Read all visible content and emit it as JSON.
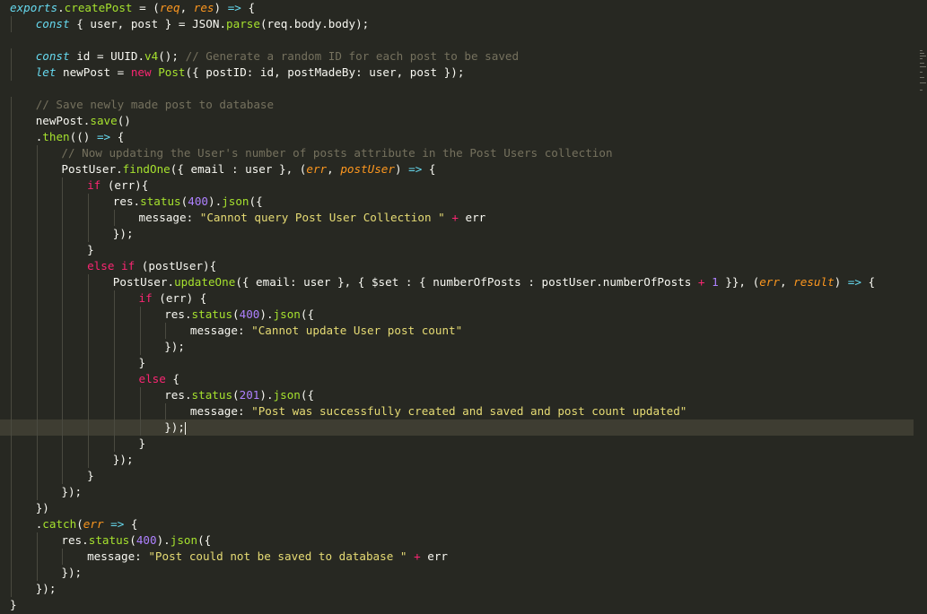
{
  "colors": {
    "background": "#272822",
    "active_line": "#3e3d32",
    "indent_guide": "#4a4a40",
    "plain": "#f8f8f2",
    "keyword": "#f92672",
    "storage": "#66d9ef",
    "function": "#a6e22e",
    "string": "#e6db74",
    "number": "#ae81ff",
    "parameter": "#fd971f",
    "comment": "#75715e"
  },
  "active_line_index": 26,
  "lines": [
    {
      "indent": 0,
      "tokens": [
        [
          "exports",
          "storage",
          true
        ],
        [
          ".",
          "plain"
        ],
        [
          "createPost",
          "function"
        ],
        [
          " = (",
          "plain"
        ],
        [
          "req",
          "parameter",
          true
        ],
        [
          ", ",
          "plain"
        ],
        [
          "res",
          "parameter",
          true
        ],
        [
          ") ",
          "plain"
        ],
        [
          "=>",
          "storage"
        ],
        [
          " {",
          "plain"
        ]
      ]
    },
    {
      "indent": 1,
      "tokens": [
        [
          "const",
          "storage",
          true
        ],
        [
          " { user, post } = ",
          "plain"
        ],
        [
          "JSON",
          "plain"
        ],
        [
          ".",
          "plain"
        ],
        [
          "parse",
          "function"
        ],
        [
          "(req.body.body);",
          "plain"
        ]
      ]
    },
    {
      "indent": 0,
      "tokens": []
    },
    {
      "indent": 1,
      "tokens": [
        [
          "const",
          "storage",
          true
        ],
        [
          " id = ",
          "plain"
        ],
        [
          "UUID",
          "plain"
        ],
        [
          ".",
          "plain"
        ],
        [
          "v4",
          "function"
        ],
        [
          "(); ",
          "plain"
        ],
        [
          "// Generate a random ID for each post to be saved",
          "comment"
        ]
      ]
    },
    {
      "indent": 1,
      "tokens": [
        [
          "let",
          "storage",
          true
        ],
        [
          " newPost = ",
          "plain"
        ],
        [
          "new",
          "keyword"
        ],
        [
          " ",
          "plain"
        ],
        [
          "Post",
          "function"
        ],
        [
          "({ postID: id, postMadeBy: user, post });",
          "plain"
        ]
      ]
    },
    {
      "indent": 0,
      "tokens": []
    },
    {
      "indent": 1,
      "tokens": [
        [
          "// Save newly made post to database",
          "comment"
        ]
      ]
    },
    {
      "indent": 1,
      "tokens": [
        [
          "newPost",
          "plain"
        ],
        [
          ".",
          "plain"
        ],
        [
          "save",
          "function"
        ],
        [
          "()",
          "plain"
        ]
      ]
    },
    {
      "indent": 1,
      "tokens": [
        [
          ".",
          "plain"
        ],
        [
          "then",
          "function"
        ],
        [
          "(() ",
          "plain"
        ],
        [
          "=>",
          "storage"
        ],
        [
          " {",
          "plain"
        ]
      ]
    },
    {
      "indent": 2,
      "tokens": [
        [
          "// Now updating the User's number of posts attribute in the Post Users collection",
          "comment"
        ]
      ]
    },
    {
      "indent": 2,
      "tokens": [
        [
          "PostUser",
          "plain"
        ],
        [
          ".",
          "plain"
        ],
        [
          "findOne",
          "function"
        ],
        [
          "({ email : user }, (",
          "plain"
        ],
        [
          "err",
          "parameter",
          true
        ],
        [
          ", ",
          "plain"
        ],
        [
          "postUser",
          "parameter",
          true
        ],
        [
          ") ",
          "plain"
        ],
        [
          "=>",
          "storage"
        ],
        [
          " {",
          "plain"
        ]
      ]
    },
    {
      "indent": 3,
      "tokens": [
        [
          "if",
          "keyword"
        ],
        [
          " (err){",
          "plain"
        ]
      ]
    },
    {
      "indent": 4,
      "tokens": [
        [
          "res",
          "plain"
        ],
        [
          ".",
          "plain"
        ],
        [
          "status",
          "function"
        ],
        [
          "(",
          "plain"
        ],
        [
          "400",
          "number"
        ],
        [
          ").",
          "plain"
        ],
        [
          "json",
          "function"
        ],
        [
          "({",
          "plain"
        ]
      ]
    },
    {
      "indent": 5,
      "tokens": [
        [
          "message: ",
          "plain"
        ],
        [
          "\"Cannot query Post User Collection \"",
          "string"
        ],
        [
          " ",
          "plain"
        ],
        [
          "+",
          "keyword"
        ],
        [
          " err",
          "plain"
        ]
      ]
    },
    {
      "indent": 4,
      "tokens": [
        [
          "});",
          "plain"
        ]
      ]
    },
    {
      "indent": 3,
      "tokens": [
        [
          "}",
          "plain"
        ]
      ]
    },
    {
      "indent": 3,
      "tokens": [
        [
          "else",
          "keyword"
        ],
        [
          " ",
          "plain"
        ],
        [
          "if",
          "keyword"
        ],
        [
          " (postUser){",
          "plain"
        ]
      ]
    },
    {
      "indent": 4,
      "tokens": [
        [
          "PostUser",
          "plain"
        ],
        [
          ".",
          "plain"
        ],
        [
          "updateOne",
          "function"
        ],
        [
          "({ email: user }, { $set : { numberOfPosts : postUser.numberOfPosts ",
          "plain"
        ],
        [
          "+",
          "keyword"
        ],
        [
          " ",
          "plain"
        ],
        [
          "1",
          "number"
        ],
        [
          " }}, (",
          "plain"
        ],
        [
          "err",
          "parameter",
          true
        ],
        [
          ", ",
          "plain"
        ],
        [
          "result",
          "parameter",
          true
        ],
        [
          ") ",
          "plain"
        ],
        [
          "=>",
          "storage"
        ],
        [
          " {",
          "plain"
        ]
      ]
    },
    {
      "indent": 5,
      "tokens": [
        [
          "if",
          "keyword"
        ],
        [
          " (err) {",
          "plain"
        ]
      ]
    },
    {
      "indent": 6,
      "tokens": [
        [
          "res",
          "plain"
        ],
        [
          ".",
          "plain"
        ],
        [
          "status",
          "function"
        ],
        [
          "(",
          "plain"
        ],
        [
          "400",
          "number"
        ],
        [
          ").",
          "plain"
        ],
        [
          "json",
          "function"
        ],
        [
          "({",
          "plain"
        ]
      ]
    },
    {
      "indent": 7,
      "tokens": [
        [
          "message: ",
          "plain"
        ],
        [
          "\"Cannot update User post count\"",
          "string"
        ]
      ]
    },
    {
      "indent": 6,
      "tokens": [
        [
          "});",
          "plain"
        ]
      ]
    },
    {
      "indent": 5,
      "tokens": [
        [
          "}",
          "plain"
        ]
      ]
    },
    {
      "indent": 5,
      "tokens": [
        [
          "else",
          "keyword"
        ],
        [
          " {",
          "plain"
        ]
      ]
    },
    {
      "indent": 6,
      "tokens": [
        [
          "res",
          "plain"
        ],
        [
          ".",
          "plain"
        ],
        [
          "status",
          "function"
        ],
        [
          "(",
          "plain"
        ],
        [
          "201",
          "number"
        ],
        [
          ").",
          "plain"
        ],
        [
          "json",
          "function"
        ],
        [
          "({",
          "plain"
        ]
      ]
    },
    {
      "indent": 7,
      "tokens": [
        [
          "message: ",
          "plain"
        ],
        [
          "\"Post was successfully created and saved and post count updated\"",
          "string"
        ]
      ]
    },
    {
      "indent": 6,
      "tokens": [
        [
          "});",
          "plain"
        ]
      ]
    },
    {
      "indent": 5,
      "tokens": [
        [
          "}",
          "plain"
        ]
      ]
    },
    {
      "indent": 4,
      "tokens": [
        [
          "});",
          "plain"
        ]
      ]
    },
    {
      "indent": 3,
      "tokens": [
        [
          "}",
          "plain"
        ]
      ]
    },
    {
      "indent": 2,
      "tokens": [
        [
          "});",
          "plain"
        ]
      ]
    },
    {
      "indent": 1,
      "tokens": [
        [
          "})",
          "plain"
        ]
      ]
    },
    {
      "indent": 1,
      "tokens": [
        [
          ".",
          "plain"
        ],
        [
          "catch",
          "function"
        ],
        [
          "(",
          "plain"
        ],
        [
          "err",
          "parameter",
          true
        ],
        [
          " ",
          "plain"
        ],
        [
          "=>",
          "storage"
        ],
        [
          " {",
          "plain"
        ]
      ]
    },
    {
      "indent": 2,
      "tokens": [
        [
          "res",
          "plain"
        ],
        [
          ".",
          "plain"
        ],
        [
          "status",
          "function"
        ],
        [
          "(",
          "plain"
        ],
        [
          "400",
          "number"
        ],
        [
          ").",
          "plain"
        ],
        [
          "json",
          "function"
        ],
        [
          "({",
          "plain"
        ]
      ]
    },
    {
      "indent": 3,
      "tokens": [
        [
          "message: ",
          "plain"
        ],
        [
          "\"Post could not be saved to database \"",
          "string"
        ],
        [
          " ",
          "plain"
        ],
        [
          "+",
          "keyword"
        ],
        [
          " err",
          "plain"
        ]
      ]
    },
    {
      "indent": 2,
      "tokens": [
        [
          "});",
          "plain"
        ]
      ]
    },
    {
      "indent": 1,
      "tokens": [
        [
          "});",
          "plain"
        ]
      ]
    },
    {
      "indent": 0,
      "tokens": [
        [
          "}",
          "plain"
        ]
      ]
    }
  ]
}
